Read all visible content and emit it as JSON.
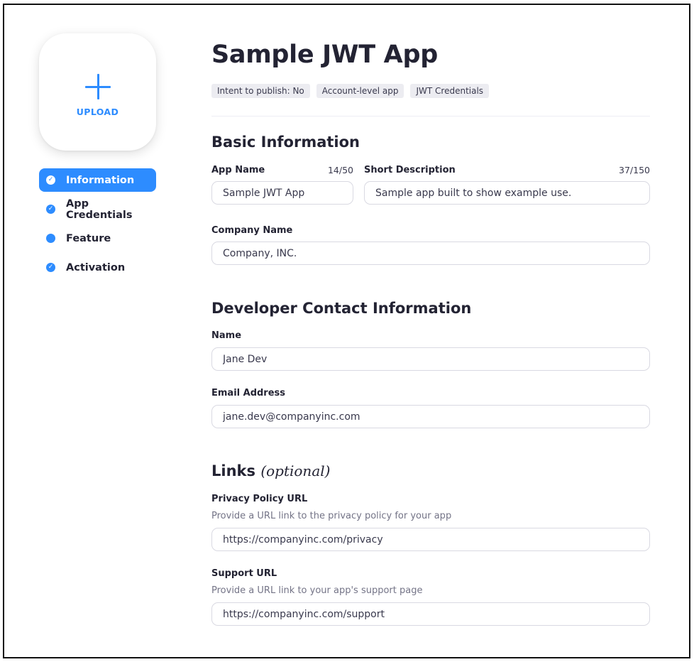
{
  "sidebar": {
    "upload_label": "UPLOAD",
    "items": [
      {
        "label": "Information",
        "icon": "check-circle-icon",
        "active": true
      },
      {
        "label": "App Credentials",
        "icon": "check-circle-icon",
        "active": false
      },
      {
        "label": "Feature",
        "icon": "dot-circle-icon",
        "active": false
      },
      {
        "label": "Activation",
        "icon": "check-circle-icon",
        "active": false
      }
    ]
  },
  "header": {
    "title": "Sample JWT App",
    "badges": [
      "Intent to publish: No",
      "Account-level app",
      "JWT Credentials"
    ]
  },
  "basic_info": {
    "title": "Basic Information",
    "app_name": {
      "label": "App Name",
      "counter": "14/50",
      "value": "Sample JWT App"
    },
    "short_description": {
      "label": "Short Description",
      "counter": "37/150",
      "value": "Sample app built to show example use."
    },
    "company_name": {
      "label": "Company Name",
      "value": "Company, INC."
    }
  },
  "developer_contact": {
    "title": "Developer Contact Information",
    "name": {
      "label": "Name",
      "value": "Jane Dev"
    },
    "email": {
      "label": "Email Address",
      "value": "jane.dev@companyinc.com"
    }
  },
  "links": {
    "title": "Links",
    "title_suffix": "(optional)",
    "privacy": {
      "label": "Privacy Policy URL",
      "helper": "Provide a URL link to the privacy policy for your app",
      "value": "https://companyinc.com/privacy"
    },
    "support": {
      "label": "Support URL",
      "helper": "Provide a URL link to your app's support page",
      "value": "https://companyinc.com/support"
    }
  },
  "colors": {
    "accent": "#2d8cff",
    "text": "#232333",
    "badge_bg": "#ececf1",
    "border": "#d9d9e2"
  }
}
